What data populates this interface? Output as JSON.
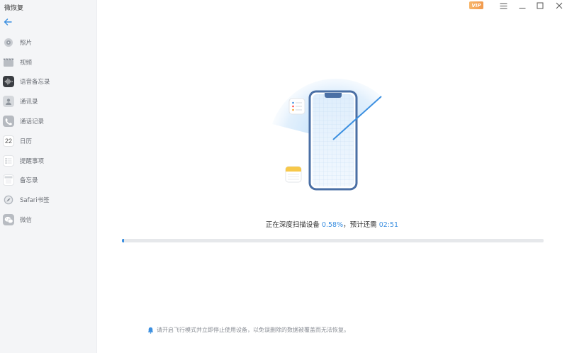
{
  "app": {
    "title": "微恢复"
  },
  "window_controls": {
    "vip_label": "VIP"
  },
  "sidebar": {
    "items": [
      {
        "label": "照片",
        "icon": "photos-icon"
      },
      {
        "label": "视频",
        "icon": "video-icon"
      },
      {
        "label": "语音备忘录",
        "icon": "voice-memo-icon"
      },
      {
        "label": "通讯录",
        "icon": "contacts-icon"
      },
      {
        "label": "通话记录",
        "icon": "phone-icon"
      },
      {
        "label": "日历",
        "icon": "calendar-icon",
        "icon_text": "22"
      },
      {
        "label": "提醒事项",
        "icon": "reminders-icon"
      },
      {
        "label": "备忘录",
        "icon": "notes-icon"
      },
      {
        "label": "Safari书签",
        "icon": "safari-icon"
      },
      {
        "label": "微信",
        "icon": "wechat-icon"
      }
    ]
  },
  "scan": {
    "status_prefix": "正在深度扫描设备",
    "percent_text": "0.58%",
    "separator": "，预计还需",
    "eta": "02:51",
    "progress": 0.0058
  },
  "tip": {
    "text": "请开启飞行模式并立即停止使用设备，以免误删除的数据被覆盖而无法恢复。"
  },
  "colors": {
    "accent": "#3b8fe0",
    "sidebar_bg": "#f4f5f7"
  }
}
